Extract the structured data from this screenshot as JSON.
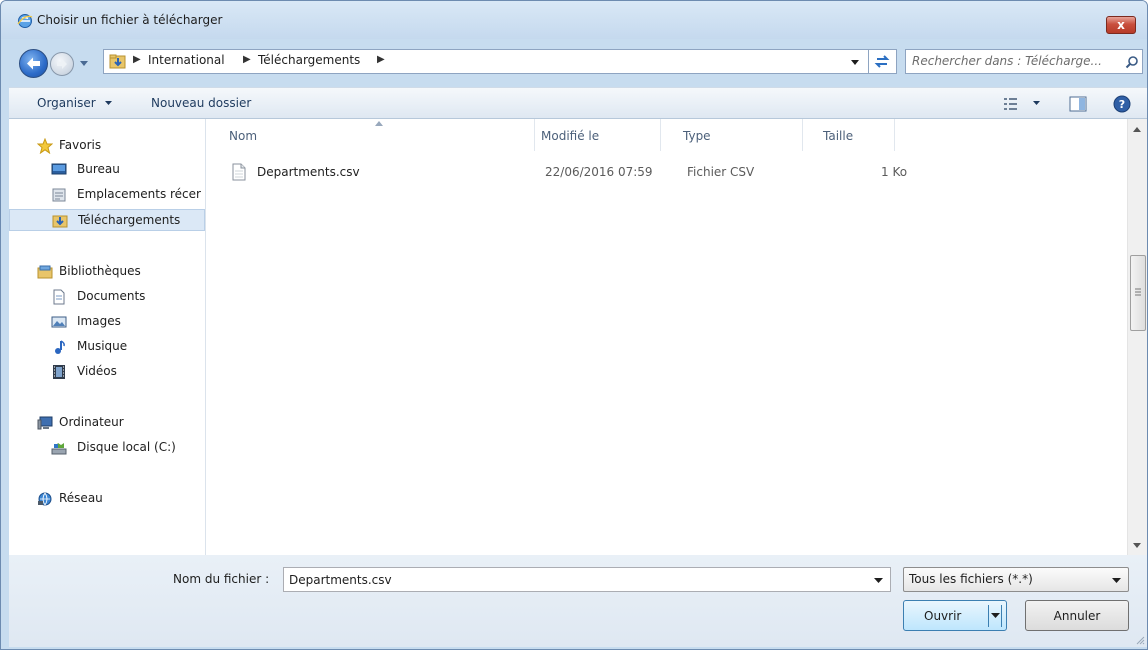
{
  "window": {
    "title": "Choisir un fichier à télécharger",
    "close_label": "x",
    "colors": {
      "title_bg": "#c7dcef",
      "close_red": "#c9503e",
      "selected_bg": "#dbe8f6"
    }
  },
  "address": {
    "crumbs": [
      "International",
      "Téléchargements"
    ],
    "search_placeholder": "Rechercher dans : Télécharge..."
  },
  "toolbar": {
    "organize_label": "Organiser",
    "new_folder_label": "Nouveau dossier"
  },
  "nav": {
    "favorites": {
      "label": "Favoris",
      "icon": "star-icon"
    },
    "favorite_items": [
      {
        "label": "Bureau",
        "icon": "desktop-icon"
      },
      {
        "label": "Emplacements récer",
        "icon": "recent-places-icon"
      },
      {
        "label": "Téléchargements",
        "icon": "downloads-folder-icon",
        "selected": true
      }
    ],
    "libraries": {
      "label": "Bibliothèques",
      "icon": "libraries-icon"
    },
    "library_items": [
      {
        "label": "Documents",
        "icon": "document-icon"
      },
      {
        "label": "Images",
        "icon": "image-icon"
      },
      {
        "label": "Musique",
        "icon": "music-icon"
      },
      {
        "label": "Vidéos",
        "icon": "video-icon"
      }
    ],
    "computer": {
      "label": "Ordinateur",
      "icon": "computer-icon"
    },
    "computer_items": [
      {
        "label": "Disque local (C:)",
        "icon": "drive-icon"
      }
    ],
    "network": {
      "label": "Réseau",
      "icon": "network-icon"
    }
  },
  "files": {
    "columns": [
      "Nom",
      "Modifié le",
      "Type",
      "Taille"
    ],
    "rows": [
      {
        "name": "Departments.csv",
        "modified": "22/06/2016 07:59",
        "type": "Fichier CSV",
        "size": "1 Ko",
        "icon": "file-icon"
      }
    ]
  },
  "footer": {
    "filename_label": "Nom du fichier :",
    "filename_value": "Departments.csv",
    "filter_value": "Tous les fichiers (*.*)",
    "open_label": "Ouvrir",
    "cancel_label": "Annuler"
  }
}
